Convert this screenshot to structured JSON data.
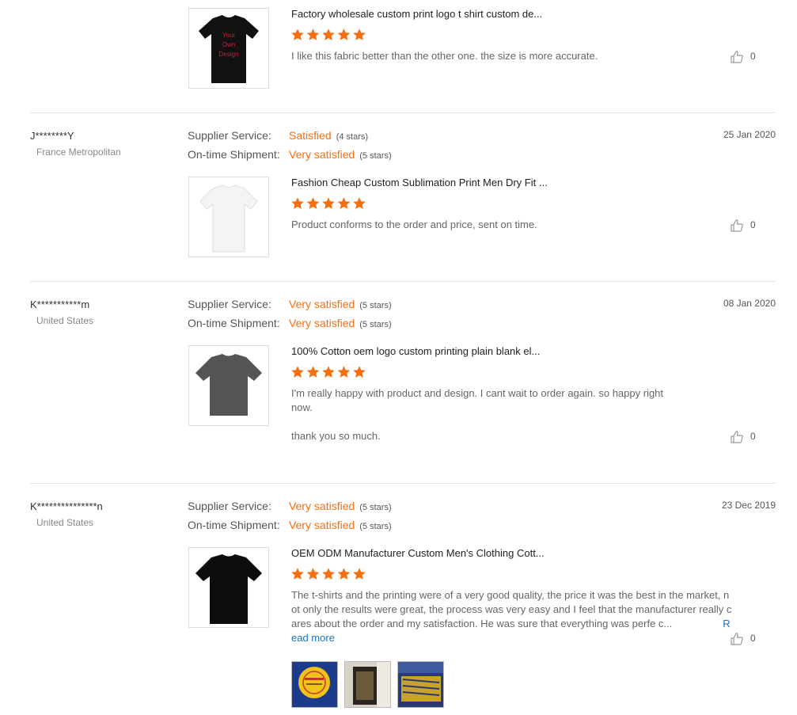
{
  "labels": {
    "supplier_service": "Supplier Service:",
    "ontime_shipment": "On-time Shipment:",
    "read_more": "Read more"
  },
  "colors": {
    "accent": "#f46f12",
    "link": "#1a73c4",
    "star": "#f46f12"
  },
  "icons": {
    "like": "thumbs-up-icon",
    "star": "star-icon"
  },
  "reviews": [
    {
      "product_title": "Factory wholesale custom print logo t shirt custom de...",
      "product_image_text": [
        "Your",
        "Own",
        "Design"
      ],
      "stars": 5,
      "comment": "I like this fabric better than the other one. the size is more accurate.",
      "likes": "0"
    },
    {
      "user": "J********Y",
      "country": "France Metropolitan",
      "date": "25 Jan 2020",
      "supplier_service": "Satisfied",
      "supplier_service_stars": "(4 stars)",
      "ontime_shipment": "Very satisfied",
      "ontime_shipment_stars": "(5 stars)",
      "product_title": "Fashion Cheap Custom Sublimation Print Men Dry Fit ...",
      "stars": 5,
      "comment": "Product conforms to the order and price, sent on time.",
      "likes": "0"
    },
    {
      "user": "K***********m",
      "country": "United States",
      "date": "08 Jan 2020",
      "supplier_service": "Very satisfied",
      "supplier_service_stars": "(5 stars)",
      "ontime_shipment": "Very satisfied",
      "ontime_shipment_stars": "(5 stars)",
      "product_title": "100% Cotton oem logo custom printing plain blank el...",
      "stars": 5,
      "comment_line1": "I'm really happy with product and design. I cant wait to order again. so happy right now.",
      "comment_line2": "thank you so much.",
      "likes": "0"
    },
    {
      "user": "K***************n",
      "country": "United States",
      "date": "23 Dec 2019",
      "supplier_service": "Very satisfied",
      "supplier_service_stars": "(5 stars)",
      "ontime_shipment": "Very satisfied",
      "ontime_shipment_stars": "(5 stars)",
      "product_title": "OEM ODM Manufacturer Custom Men's Clothing Cott...",
      "stars": 5,
      "comment": "The t-shirts and the printing were of a very good quality, the price it was the best in the market, not only the results were great, the process was very easy and I feel that the manufacturer really cares about the order and my satisfaction. He was sure that everything was perfe c...",
      "likes": "0",
      "photo_count": 3
    }
  ]
}
